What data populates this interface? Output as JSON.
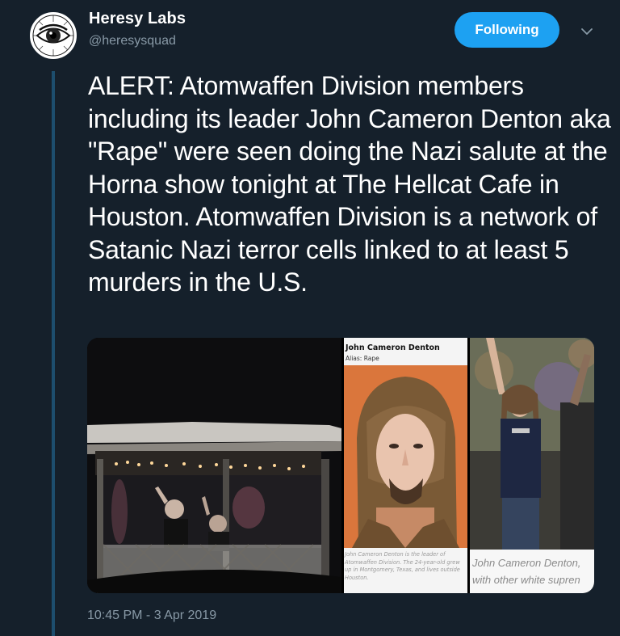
{
  "tweet": {
    "author": {
      "name": "Heresy Labs",
      "handle": "@heresysquad"
    },
    "follow_button": "Following",
    "text": "ALERT: Atomwaffen Division members including its leader John Cameron Denton aka \"Rape\" were seen doing the Nazi salute at the Horna show tonight at The Hellcat Cafe in Houston. Atomwaffen Division is a network of Satanic Nazi terror cells linked to at least 5 murders in the U.S.",
    "timestamp": "10:45 PM - 3 Apr 2019",
    "media": {
      "middle": {
        "name": "John Cameron Denton",
        "alias": "Alias: Rape",
        "caption": "John Cameron Denton is the leader of Atomwaffen Division. The 24-year-old grew up in Montgomery, Texas, and lives outside Houston."
      },
      "right": {
        "caption_line1": "John Cameron Denton,",
        "caption_line2": "with other white supren"
      }
    }
  },
  "icons": {
    "avatar": "eye-logo-icon",
    "more": "chevron-down-icon"
  },
  "colors": {
    "background": "#15202b",
    "accent": "#1da1f2",
    "secondary_text": "#8899a6",
    "thread_line": "#1d4e6e"
  }
}
